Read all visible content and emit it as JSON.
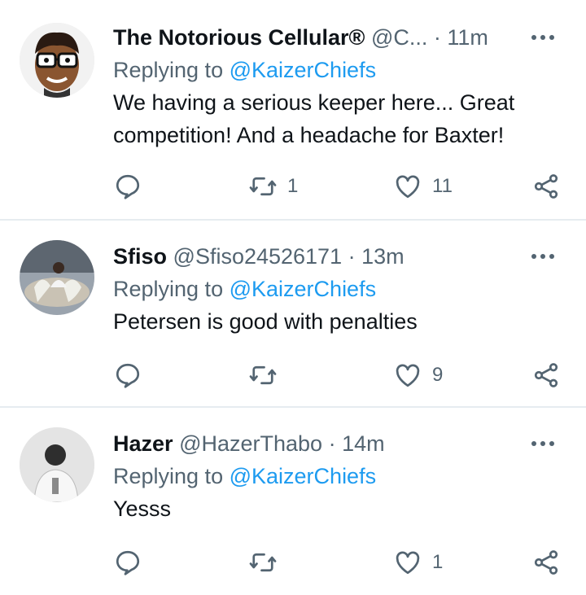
{
  "tweets": [
    {
      "name": "The Notorious Cellular®",
      "handle": "@C...",
      "dot": "·",
      "time": "11m",
      "replying_prefix": "Replying to",
      "replying_to": "@KaizerChiefs",
      "text_lines": [
        "We having a serious keeper here... Great",
        "competition! And a headache for Baxter!"
      ],
      "retweets": "1",
      "likes": "11",
      "avatar_icon": "cartoon-face-avatar"
    },
    {
      "name": "Sfiso",
      "handle": "@Sfiso24526171",
      "dot": "·",
      "time": "13m",
      "replying_prefix": "Replying to",
      "replying_to": "@KaizerChiefs",
      "text_lines": [
        "Petersen is good with penalties"
      ],
      "retweets": "",
      "likes": "9",
      "avatar_icon": "photo-avatar"
    },
    {
      "name": "Hazer",
      "handle": "@HazerThabo",
      "dot": "·",
      "time": "14m",
      "replying_prefix": "Replying to",
      "replying_to": "@KaizerChiefs",
      "text_lines": [
        "Yesss"
      ],
      "retweets": "",
      "likes": "1",
      "avatar_icon": "grayscale-photo-avatar"
    }
  ],
  "colors": {
    "accent": "#1d9bf0",
    "secondary_text": "#536471",
    "primary_text": "#0f1419",
    "divider": "#e6ecf0"
  },
  "icons": {
    "reply": "reply-icon",
    "retweet": "retweet-icon",
    "like": "heart-icon",
    "share": "share-icon",
    "more": "more-options-icon"
  }
}
